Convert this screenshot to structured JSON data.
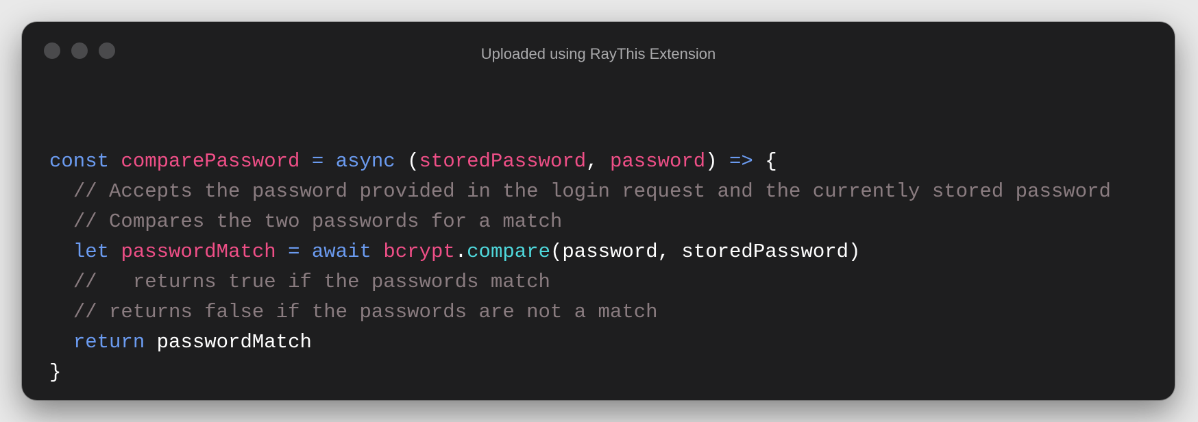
{
  "window": {
    "title": "Uploaded using RayThis Extension",
    "controls": [
      "close",
      "minimize",
      "zoom"
    ]
  },
  "colors": {
    "keyword": "#6b9bf0",
    "identifier": "#ef4f87",
    "method": "#4fd8dc",
    "comment": "#8a7c80",
    "plain": "#ffffff"
  },
  "code": {
    "language": "javascript",
    "lines": [
      [
        {
          "t": "const",
          "c": "keyword"
        },
        {
          "t": " ",
          "c": "plain"
        },
        {
          "t": "comparePassword",
          "c": "identifier"
        },
        {
          "t": " ",
          "c": "plain"
        },
        {
          "t": "=",
          "c": "keyword"
        },
        {
          "t": " ",
          "c": "plain"
        },
        {
          "t": "async",
          "c": "keyword"
        },
        {
          "t": " (",
          "c": "plain"
        },
        {
          "t": "storedPassword",
          "c": "identifier"
        },
        {
          "t": ", ",
          "c": "plain"
        },
        {
          "t": "password",
          "c": "identifier"
        },
        {
          "t": ") ",
          "c": "plain"
        },
        {
          "t": "=>",
          "c": "keyword"
        },
        {
          "t": " {",
          "c": "plain"
        }
      ],
      [
        {
          "t": "  ",
          "c": "plain"
        },
        {
          "t": "// Accepts the password provided in the login request and the currently stored password",
          "c": "comment"
        }
      ],
      [
        {
          "t": "  ",
          "c": "plain"
        },
        {
          "t": "// Compares the two passwords for a match",
          "c": "comment"
        }
      ],
      [
        {
          "t": "  ",
          "c": "plain"
        },
        {
          "t": "let",
          "c": "keyword"
        },
        {
          "t": " ",
          "c": "plain"
        },
        {
          "t": "passwordMatch",
          "c": "identifier"
        },
        {
          "t": " ",
          "c": "plain"
        },
        {
          "t": "=",
          "c": "keyword"
        },
        {
          "t": " ",
          "c": "plain"
        },
        {
          "t": "await",
          "c": "keyword"
        },
        {
          "t": " ",
          "c": "plain"
        },
        {
          "t": "bcrypt",
          "c": "identifier"
        },
        {
          "t": ".",
          "c": "plain"
        },
        {
          "t": "compare",
          "c": "method"
        },
        {
          "t": "(password, storedPassword)",
          "c": "plain"
        }
      ],
      [
        {
          "t": "  ",
          "c": "plain"
        },
        {
          "t": "//   returns true if the passwords match",
          "c": "comment"
        }
      ],
      [
        {
          "t": "  ",
          "c": "plain"
        },
        {
          "t": "// returns false if the passwords are not a match",
          "c": "comment"
        }
      ],
      [
        {
          "t": "  ",
          "c": "plain"
        },
        {
          "t": "return",
          "c": "keyword"
        },
        {
          "t": " passwordMatch",
          "c": "plain"
        }
      ],
      [
        {
          "t": "}",
          "c": "plain"
        }
      ]
    ]
  }
}
